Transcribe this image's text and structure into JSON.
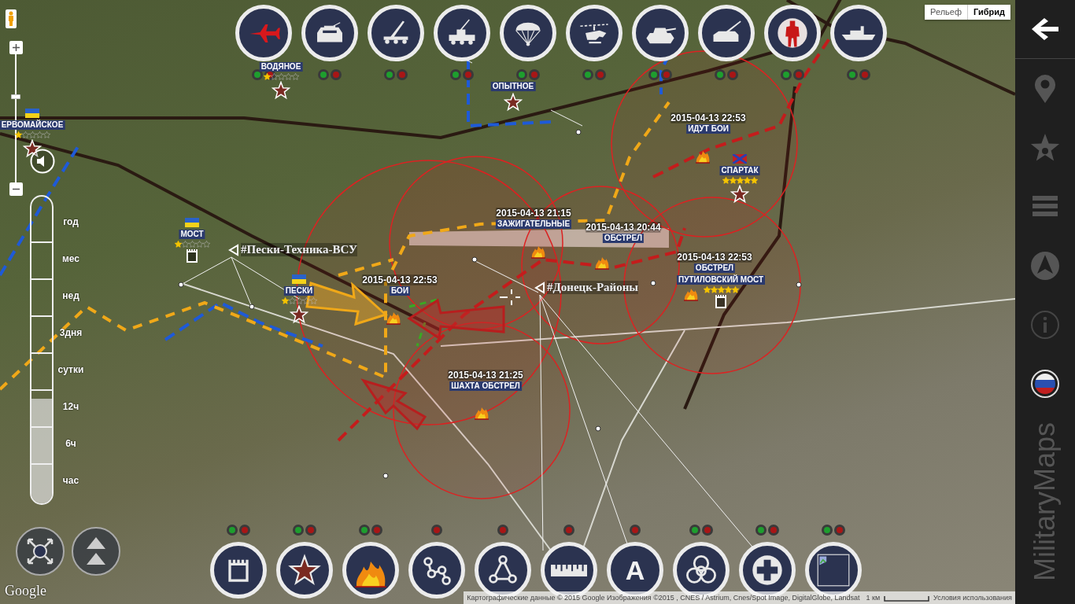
{
  "map_type": [
    {
      "label": "Рельеф",
      "selected": false
    },
    {
      "label": "Гибрид",
      "selected": true
    }
  ],
  "top_toolbar": [
    {
      "kind": "aircraft",
      "indicators": [
        {
          "color": "#1e9e2e"
        },
        {
          "color": "#a81616"
        }
      ]
    },
    {
      "kind": "armored_car",
      "indicators": [
        {
          "color": "#1e9e2e"
        },
        {
          "color": "#a81616"
        }
      ]
    },
    {
      "kind": "rocket_launcher",
      "indicators": [
        {
          "color": "#1e9e2e"
        },
        {
          "color": "#a81616"
        }
      ]
    },
    {
      "kind": "missile_vehicle",
      "indicators": [
        {
          "color": "#1e9e2e"
        },
        {
          "color": "#a81616"
        }
      ]
    },
    {
      "kind": "paratroopers",
      "indicators": [
        {
          "color": "#1e9e2e"
        },
        {
          "color": "#a81616"
        }
      ]
    },
    {
      "kind": "helicopter",
      "indicators": [
        {
          "color": "#1e9e2e"
        },
        {
          "color": "#a81616"
        }
      ]
    },
    {
      "kind": "tank",
      "indicators": [
        {
          "color": "#1e9e2e"
        },
        {
          "color": "#a81616"
        }
      ]
    },
    {
      "kind": "artillery",
      "indicators": [
        {
          "color": "#1e9e2e"
        },
        {
          "color": "#a81616"
        }
      ]
    },
    {
      "kind": "soldier",
      "indicators": [
        {
          "color": "#1e9e2e"
        },
        {
          "color": "#a81616"
        }
      ]
    },
    {
      "kind": "ship",
      "indicators": [
        {
          "color": "#1e9e2e"
        },
        {
          "color": "#a81616"
        }
      ]
    }
  ],
  "bottom_toolbar": [
    {
      "kind": "fortification",
      "indicators": [
        {
          "color": "#1e9e2e"
        },
        {
          "color": "#a81616"
        }
      ]
    },
    {
      "kind": "star",
      "indicators": [
        {
          "color": "#1e9e2e"
        },
        {
          "color": "#a81616"
        }
      ]
    },
    {
      "kind": "fire",
      "indicators": [
        {
          "color": "#1e9e2e"
        },
        {
          "color": "#a81616"
        }
      ]
    },
    {
      "kind": "route",
      "indicators": [
        {
          "color": "#a81616"
        }
      ]
    },
    {
      "kind": "triangle",
      "indicators": [
        {
          "color": "#a81616"
        }
      ]
    },
    {
      "kind": "ruler",
      "indicators": [
        {
          "color": "#a81616"
        }
      ]
    },
    {
      "kind": "text",
      "label": "A",
      "indicators": [
        {
          "color": "#a81616"
        }
      ]
    },
    {
      "kind": "biohazard",
      "indicators": [
        {
          "color": "#1e9e2e"
        },
        {
          "color": "#a81616"
        }
      ]
    },
    {
      "kind": "medical",
      "indicators": [
        {
          "color": "#1e9e2e"
        },
        {
          "color": "#a81616"
        }
      ]
    },
    {
      "kind": "image",
      "indicators": [
        {
          "color": "#1e9e2e"
        },
        {
          "color": "#a81616"
        }
      ]
    }
  ],
  "sidebar": {
    "items": [
      {
        "kind": "back",
        "active": true
      },
      {
        "kind": "pin",
        "active": false
      },
      {
        "kind": "star",
        "active": false
      },
      {
        "kind": "list",
        "active": false
      },
      {
        "kind": "navigation",
        "active": false
      },
      {
        "kind": "info",
        "active": false
      },
      {
        "kind": "language",
        "active": true
      }
    ],
    "title": "MilitaryMaps"
  },
  "time_slider": {
    "labels": [
      "год",
      "мес",
      "нед",
      "3дня",
      "сутки",
      "12ч",
      "6ч",
      "час"
    ],
    "level": 0.34
  },
  "places": [
    {
      "name": "ВОДЯНОЕ",
      "stars": 1,
      "kind": "star"
    },
    {
      "name": "ОПЫТНОЕ",
      "kind": "star"
    },
    {
      "name": "ЕРВОМАЙСКОЕ",
      "flag": {
        "parts": [
          {
            "color": "#2a62c8"
          },
          {
            "color": "#f3d21a"
          }
        ],
        "saltire": false
      },
      "stars": 1,
      "kind": "star"
    },
    {
      "name": "МОСТ",
      "flag": {
        "parts": [
          {
            "color": "#2a62c8"
          },
          {
            "color": "#f3d21a"
          }
        ],
        "saltire": false
      },
      "stars": 1,
      "kind": "fort"
    },
    {
      "name": "ПЕСКИ",
      "flag": {
        "parts": [
          {
            "color": "#2a62c8"
          },
          {
            "color": "#f3d21a"
          }
        ],
        "saltire": false
      },
      "stars": 1,
      "kind": "star"
    },
    {
      "name": "СПАРТАК",
      "flag": {
        "parts": [
          {
            "color": "#c8201e"
          },
          {
            "color": "#2a40b0"
          }
        ],
        "saltire": true
      },
      "stars": 5,
      "kind": "star"
    },
    {
      "name": "ПУТИЛОВСКИЙ МОСТ",
      "stars": 5,
      "kind": "fort"
    }
  ],
  "events": [
    {
      "date": "2015-04-13 22:53",
      "title": "ИДУТ БОИ"
    },
    {
      "date": "2015-04-13 21:15",
      "title": "ЗАЖИГАТЕЛЬНЫЕ"
    },
    {
      "date": "2015-04-13 20:44",
      "title": "ОБСТРЕЛ"
    },
    {
      "date": "2015-04-13 22:53",
      "title": "ОБСТРЕЛ"
    },
    {
      "date": "2015-04-13 22:53",
      "title": "БОИ"
    },
    {
      "date": "2015-04-13 21:25",
      "title": "ШАХТА ОБСТРЕЛ"
    }
  ],
  "hashtags": [
    "#Пески-Техника-ВСУ",
    "#Донецк-Районы"
  ],
  "attribution": {
    "logo": "Google",
    "text": "Картографические данные © 2015 Google Изображения ©2015 , CNES / Astrium, Cnes/Spot Image, DigitalGlobe, Landsat",
    "scale": "1 км",
    "terms": "Условия использования"
  }
}
